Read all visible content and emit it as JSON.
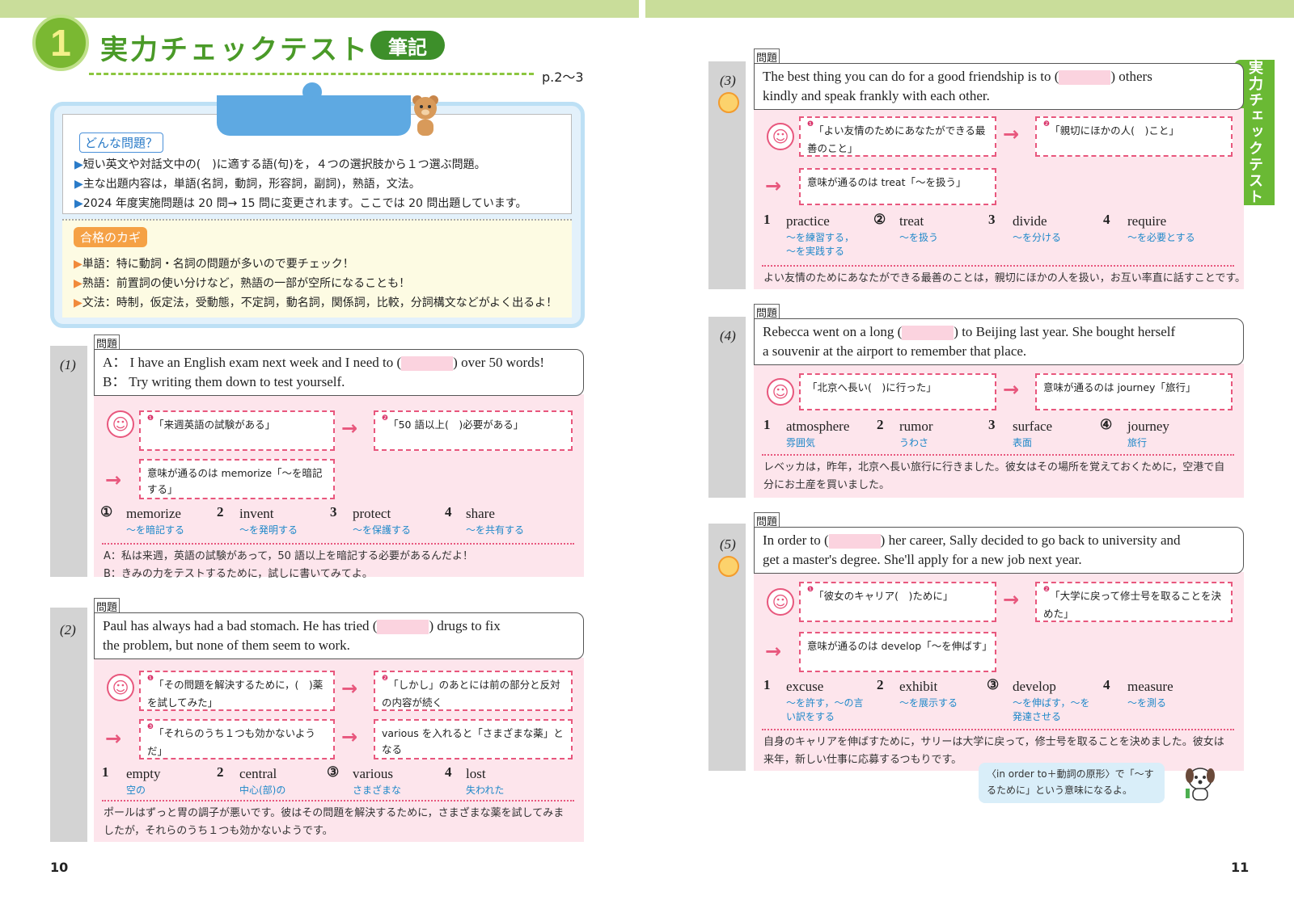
{
  "header": {
    "num": "1",
    "title": "実力チェックテスト",
    "tag": "筆記",
    "pages": "p.2～3"
  },
  "info": {
    "title": "どんな問題？",
    "b1": "短い英文や対話文中の(　)に適する語(句)を，４つの選択肢から１つ選ぶ問題。",
    "b2": "主な出題内容は，単語(名詞，動詞，形容詞，副詞)，熟語，文法。",
    "b3": "2024 年度実施問題は 20 問→ 15 問に変更されます。ここでは 20 問出題しています。",
    "keytitle": "合格のカギ",
    "k1": "単語：特に動詞・名詞の問題が多いので要チェック！",
    "k2": "熟語：前置詞の使い分けなど，熟語の一部が空所になることも！",
    "k3": "文法：時制，仮定法，受動態，不定詞，動名詞，関係詞，比較，分詞構文などがよく出るよ！"
  },
  "q_label": "問題",
  "q1": {
    "num": "(1)",
    "lineA1": "A： I have an English exam next week and I need to (",
    "lineA2": ") over 50 words!",
    "lineB": "B： Try writing them down to test yourself.",
    "h1": "「来週英語の試験がある」",
    "h2": "「50 語以上(　)必要がある」",
    "h3": "意味が通るのは memorize「～を暗記する」",
    "choices": [
      {
        "n": "①",
        "w": "memorize",
        "j": "～を暗記する"
      },
      {
        "n": "2",
        "w": "invent",
        "j": "～を発明する"
      },
      {
        "n": "3",
        "w": "protect",
        "j": "～を保護する"
      },
      {
        "n": "4",
        "w": "share",
        "j": "～を共有する"
      }
    ],
    "t1": "A：私は来週，英語の試験があって，50 語以上を暗記する必要があるんだよ！",
    "t2": "B：きみの力をテストするために，試しに書いてみてよ。"
  },
  "q2": {
    "num": "(2)",
    "line1a": "Paul has always had a bad stomach.  He has tried (",
    "line1b": ") drugs to fix",
    "line2": "the problem, but none of them seem to work.",
    "h1": "「その問題を解決するために，(　)薬を試してみた」",
    "h2": "「しかし」のあとには前の部分と反対の内容が続く",
    "h3": "「それらのうち１つも効かないようだ」",
    "h4": "various を入れると「さまざまな薬」となる",
    "choices": [
      {
        "n": "1",
        "w": "empty",
        "j": "空の"
      },
      {
        "n": "2",
        "w": "central",
        "j": "中心(部)の"
      },
      {
        "n": "③",
        "w": "various",
        "j": "さまざまな"
      },
      {
        "n": "4",
        "w": "lost",
        "j": "失われた"
      }
    ],
    "t1": "ポールはずっと胃の調子が悪いです。彼はその問題を解決するために，さまざまな薬を試してみま",
    "t2": "したが，それらのうち１つも効かないようです。"
  },
  "q3": {
    "num": "(3)",
    "line1a": "The best thing you can do for a good friendship is to (",
    "line1b": ") others",
    "line2": "kindly and speak frankly with each other.",
    "h1": "「よい友情のためにあなたができる最善のこと」",
    "h2": "「親切にほかの人(　)こと」",
    "h3": "意味が通るのは treat「～を扱う」",
    "choices": [
      {
        "n": "1",
        "w": "practice",
        "j": "～を練習する，～を実践する"
      },
      {
        "n": "②",
        "w": "treat",
        "j": "～を扱う"
      },
      {
        "n": "3",
        "w": "divide",
        "j": "～を分ける"
      },
      {
        "n": "4",
        "w": "require",
        "j": "～を必要とする"
      }
    ],
    "t1": "よい友情のためにあなたができる最善のことは，親切にほかの人を扱い，お互い率直に話すことです。"
  },
  "q4": {
    "num": "(4)",
    "line1a": "Rebecca went on a long (",
    "line1b": ") to Beijing last year.  She bought herself",
    "line2": "a souvenir at the airport to remember that place.",
    "h1": "「北京へ長い(　)に行った」",
    "h2": "意味が通るのは journey「旅行」",
    "choices": [
      {
        "n": "1",
        "w": "atmosphere",
        "j": "雰囲気"
      },
      {
        "n": "2",
        "w": "rumor",
        "j": "うわさ"
      },
      {
        "n": "3",
        "w": "surface",
        "j": "表面"
      },
      {
        "n": "④",
        "w": "journey",
        "j": "旅行"
      }
    ],
    "t1": "レベッカは，昨年，北京へ長い旅行に行きました。彼女はその場所を覚えておくために，空港で自",
    "t2": "分にお土産を買いました。"
  },
  "q5": {
    "num": "(5)",
    "line1a": "In order to (",
    "line1b": ") her career, Sally decided to go back to university and",
    "line2": "get a master's degree.  She'll apply for a new job next year.",
    "h1": "「彼女のキャリア(　)ために」",
    "h2": "「大学に戻って修士号を取ることを決めた」",
    "h3": "意味が通るのは develop「～を伸ばす」",
    "choices": [
      {
        "n": "1",
        "w": "excuse",
        "j": "～を許す，～の言い訳をする"
      },
      {
        "n": "2",
        "w": "exhibit",
        "j": "～を展示する"
      },
      {
        "n": "③",
        "w": "develop",
        "j": "～を伸ばす，～を発達させる"
      },
      {
        "n": "4",
        "w": "measure",
        "j": "～を測る"
      }
    ],
    "t1": "自身のキャリアを伸ばすために，サリーは大学に戻って，修士号を取ることを決めました。彼女は",
    "t2": "来年，新しい仕事に応募するつもりです。"
  },
  "note": "〈in order to＋動詞の原形〉で「～するために」という意味になるよ。",
  "side_tab": "実力チェックテスト",
  "page_left": "10",
  "page_right": "11"
}
